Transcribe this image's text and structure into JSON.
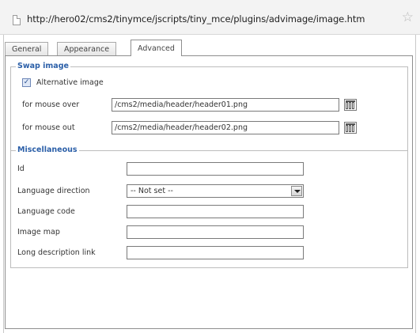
{
  "browser": {
    "url": "http://hero02/cms2/tinymce/jscripts/tiny_mce/plugins/advimage/image.htm"
  },
  "tabs": [
    "General",
    "Appearance",
    "Advanced"
  ],
  "swap_image": {
    "legend": "Swap image",
    "alt_checkbox_label": "Alternative image",
    "alt_checked": true,
    "mouse_over_label": "for mouse over",
    "mouse_over_value": "/cms2/media/header/header01.png",
    "mouse_out_label": "for mouse out",
    "mouse_out_value": "/cms2/media/header/header02.png"
  },
  "misc": {
    "legend": "Miscellaneous",
    "id_label": "Id",
    "id_value": "",
    "lang_dir_label": "Language direction",
    "lang_dir_value": "-- Not set --",
    "lang_code_label": "Language code",
    "lang_code_value": "",
    "image_map_label": "Image map",
    "image_map_value": "",
    "longdesc_label": "Long description link",
    "longdesc_value": ""
  },
  "icons": {
    "page": "page-icon",
    "star": "star-icon",
    "browse": "browse-icon"
  }
}
